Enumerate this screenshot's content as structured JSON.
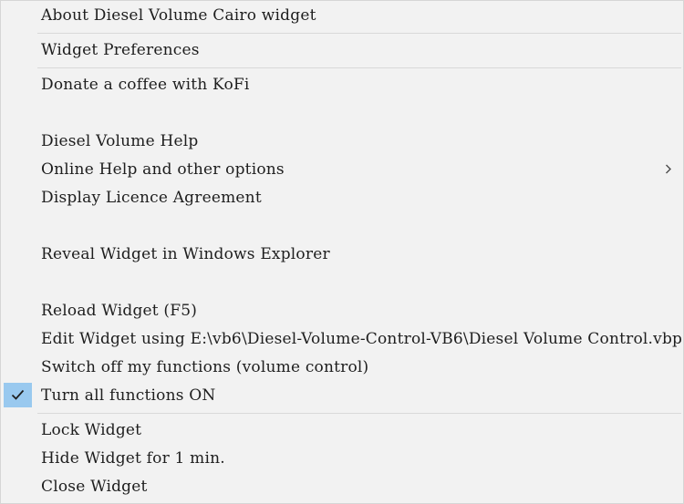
{
  "menu": {
    "items": [
      {
        "label": "About Diesel Volume Cairo widget"
      },
      {
        "label": "Widget Preferences"
      },
      {
        "label": "Donate a coffee with KoFi"
      },
      {
        "label": "Diesel Volume Help"
      },
      {
        "label": "Online Help and other options"
      },
      {
        "label": "Display Licence Agreement"
      },
      {
        "label": "Reveal Widget in Windows Explorer"
      },
      {
        "label": "Reload Widget (F5)"
      },
      {
        "label": "Edit Widget using E:\\vb6\\Diesel-Volume-Control-VB6\\Diesel Volume Control.vbp"
      },
      {
        "label": "Switch off my functions (volume control)"
      },
      {
        "label": "Turn all functions ON",
        "checked": true
      },
      {
        "label": "Lock Widget"
      },
      {
        "label": "Hide Widget for 1 min."
      },
      {
        "label": "Close Widget"
      }
    ],
    "icons": {
      "checkmark": "checkmark-icon",
      "submenu": "chevron-right-icon"
    },
    "colors": {
      "background": "#f2f2f2",
      "checked_highlight": "#99c9ef",
      "separator": "#d9d9d9",
      "text": "#1e1e1e"
    }
  }
}
